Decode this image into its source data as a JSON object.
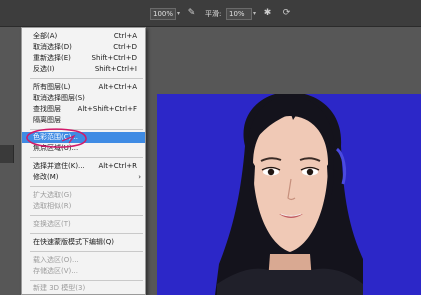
{
  "options_bar": {
    "opacity": "100%",
    "smoothing_label": "平滑:",
    "smoothing": "10%"
  },
  "menu": {
    "items": [
      {
        "label": "全部(A)",
        "shortcut": "Ctrl+A",
        "enabled": true
      },
      {
        "label": "取消选择(D)",
        "shortcut": "Ctrl+D",
        "enabled": true
      },
      {
        "label": "重新选择(E)",
        "shortcut": "Shift+Ctrl+D",
        "enabled": true
      },
      {
        "label": "反选(I)",
        "shortcut": "Shift+Ctrl+I",
        "enabled": true
      },
      {
        "label": "所有图层(L)",
        "shortcut": "Alt+Ctrl+A",
        "enabled": true
      },
      {
        "label": "取消选择图层(S)",
        "shortcut": "",
        "enabled": true
      },
      {
        "label": "查找图层",
        "shortcut": "Alt+Shift+Ctrl+F",
        "enabled": true
      },
      {
        "label": "隔离图层",
        "shortcut": "",
        "enabled": true
      },
      {
        "label": "色彩范围(C)...",
        "shortcut": "",
        "enabled": true,
        "highlighted": true
      },
      {
        "label": "焦点区域(U)...",
        "shortcut": "",
        "enabled": true
      },
      {
        "label": "选择并遮住(K)...",
        "shortcut": "Alt+Ctrl+R",
        "enabled": true
      },
      {
        "label": "修改(M)",
        "shortcut": "",
        "enabled": true,
        "submenu": true
      },
      {
        "label": "扩大选取(G)",
        "shortcut": "",
        "enabled": false
      },
      {
        "label": "选取相似(R)",
        "shortcut": "",
        "enabled": false
      },
      {
        "label": "变换选区(T)",
        "shortcut": "",
        "enabled": false
      },
      {
        "label": "在快速蒙版模式下编辑(Q)",
        "shortcut": "",
        "enabled": true
      },
      {
        "label": "载入选区(O)...",
        "shortcut": "",
        "enabled": false
      },
      {
        "label": "存储选区(V)...",
        "shortcut": "",
        "enabled": false
      },
      {
        "label": "新建 3D 模型(3)",
        "shortcut": "",
        "enabled": false
      }
    ]
  },
  "colors": {
    "canvas_background": "#2c27c8",
    "menu_highlight": "#3f8be4",
    "annotation": "#d11a6a"
  }
}
